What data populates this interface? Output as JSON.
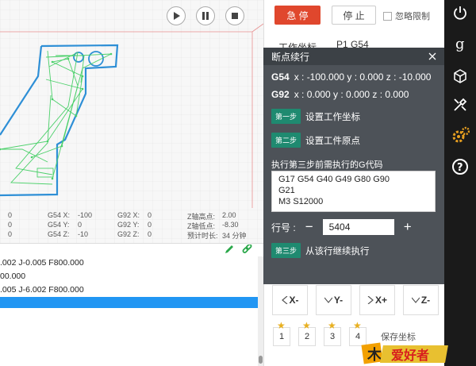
{
  "viewport": {
    "readout": {
      "col1": [
        "0",
        "0",
        "0"
      ],
      "g54_labels": [
        "G54  X:",
        "G54  Y:",
        "G54  Z:"
      ],
      "g54_values": [
        "-100",
        "0",
        "-10"
      ],
      "g92_labels": [
        "G92  X:",
        "G92  Y:",
        "G92  Z:"
      ],
      "g92_values": [
        "0",
        "0",
        "0"
      ],
      "z_labels": [
        "Z轴高点:",
        "Z轴低点:",
        "预计时长:"
      ],
      "z_values": [
        "2.00",
        "-8.30",
        "34 分钟"
      ]
    }
  },
  "gcode": {
    "lines": [
      ".002 J-0.005 F800.000",
      "00.000",
      ".005 J-6.002 F800.000",
      ""
    ]
  },
  "controls": {
    "estop_label": "急  停",
    "stop_label": "停  止",
    "ignore_limit_label": "忽略限制",
    "wcs_label": "工作坐标",
    "wcs_value": "P1 G54",
    "jog": [
      {
        "icon": "chevron-left",
        "label": "X-"
      },
      {
        "icon": "chevron-down",
        "label": "Y-"
      },
      {
        "icon": "chevron-right",
        "label": "X+"
      },
      {
        "icon": "chevron-down",
        "label": "Z-"
      }
    ],
    "slots": [
      "1",
      "2",
      "3",
      "4"
    ],
    "save_coord_label": "保存坐标"
  },
  "modal": {
    "title": "断点续行",
    "g54": {
      "label": "G54",
      "coords": "x : -100.000  y : 0.000  z : -10.000"
    },
    "g92": {
      "label": "G92",
      "coords": "x : 0.000  y : 0.000  z : 0.000"
    },
    "step1": {
      "badge": "第一步",
      "label": "设置工作坐标"
    },
    "step2": {
      "badge": "第二步",
      "label": "设置工件原点"
    },
    "gcode_hint": "执行第三步前需执行的G代码",
    "gcode_text": "G17 G54 G40 G49 G80 G90\nG21\nM3 S12000",
    "line_label": "行号 :",
    "line_value": "5404",
    "minus": "−",
    "plus": "+",
    "step3": {
      "badge": "第三步",
      "label": "从该行继续执行"
    }
  },
  "sidebar_icons": [
    "power-icon",
    "g-code-icon",
    "cube-icon",
    "tools-icon",
    "settings-icon",
    "help-icon"
  ],
  "colors": {
    "estop": "#e0472d",
    "step_badge": "#1f8a70",
    "modal_bg": "#4d5258",
    "toolpath": "#2e8fd6",
    "highlight": "#2196f3"
  }
}
